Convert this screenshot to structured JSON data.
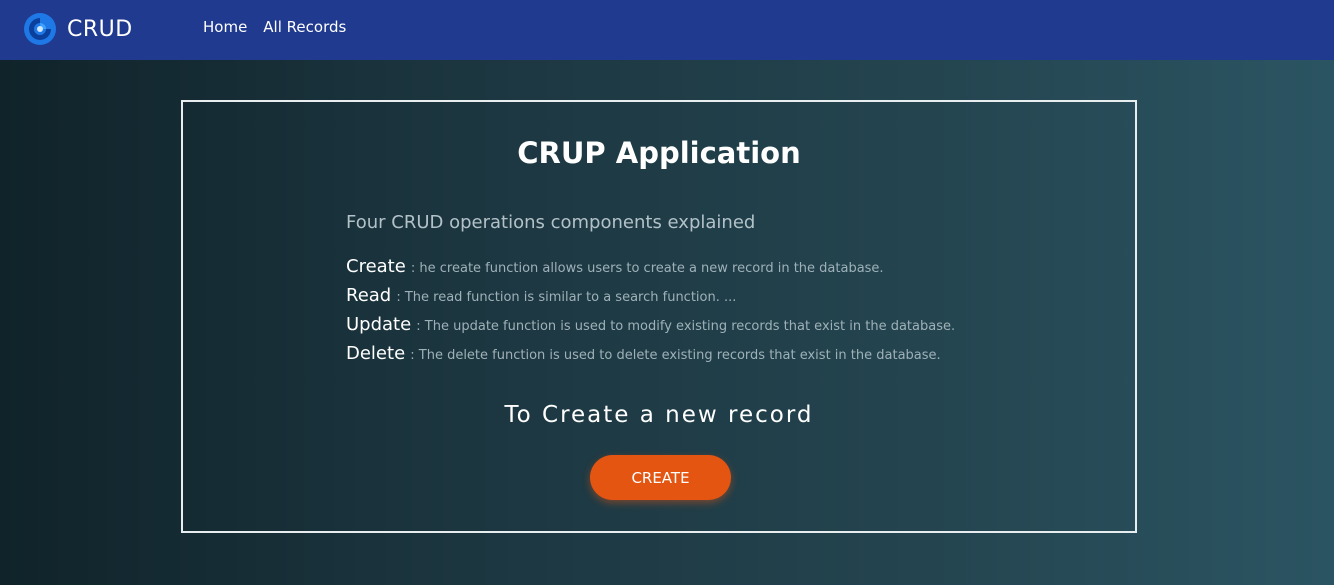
{
  "navbar": {
    "brand": "CRUD",
    "links": [
      "Home",
      "All Records"
    ],
    "logo_icon": "swirl-logo-icon"
  },
  "card": {
    "title": "CRUP Application",
    "subtitle": "Four CRUD operations components explained",
    "operations": [
      {
        "name": "Create",
        "description": ": he create function allows users to create a new record in the database."
      },
      {
        "name": "Read",
        "description": ": The read function is similar to a search function. ..."
      },
      {
        "name": "Update",
        "description": ": The update function is used to modify existing records that exist in the database."
      },
      {
        "name": "Delete",
        "description": ": The delete function is used to delete existing records that exist in the database."
      }
    ],
    "cta_text": "To Create a new record",
    "create_button": "CREATE"
  },
  "colors": {
    "navbar": "#1f3a8e",
    "button": "#e45512",
    "background_start": "#10232a",
    "background_end": "#2b5462"
  }
}
